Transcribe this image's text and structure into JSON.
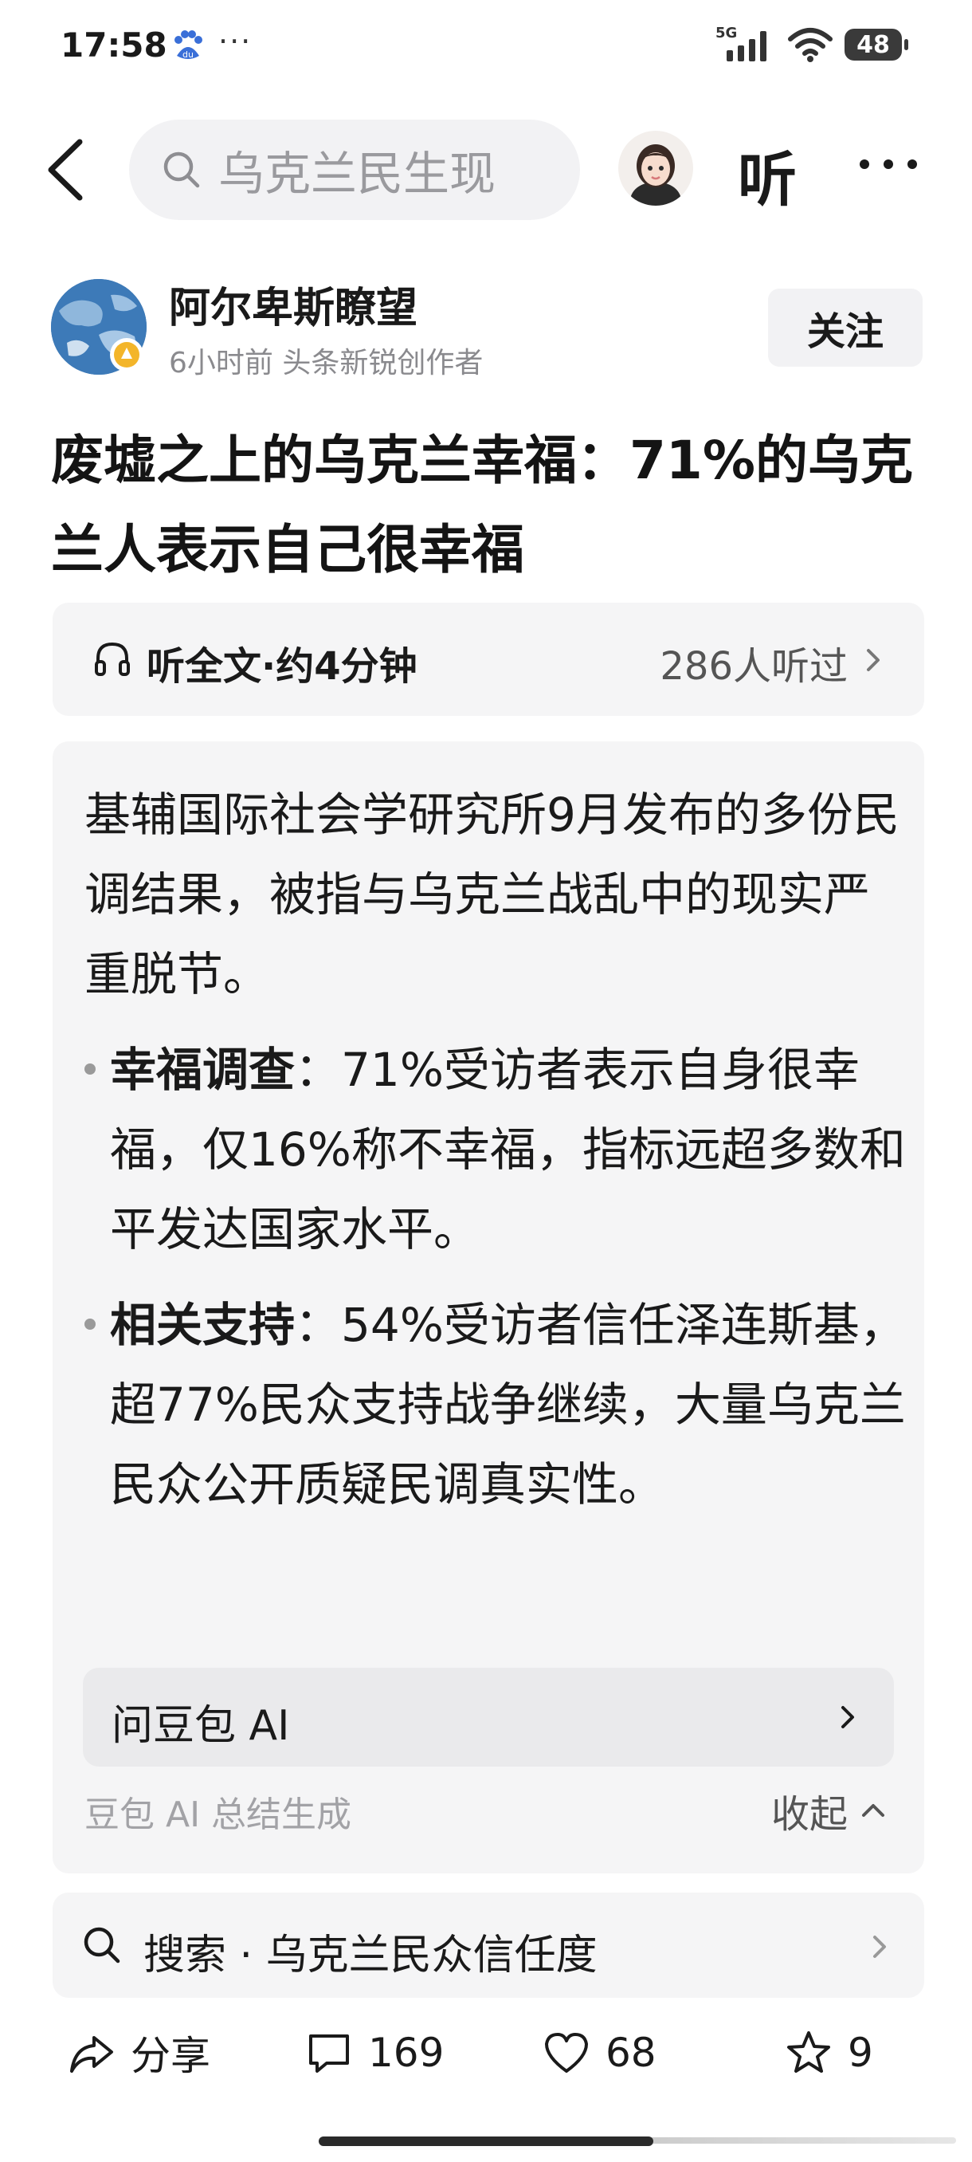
{
  "status_bar": {
    "time": "17:58",
    "network": "5G",
    "battery": "48"
  },
  "nav": {
    "search_text": "乌克兰民生现",
    "listen_label": "听"
  },
  "author": {
    "name": "阿尔卑斯瞭望",
    "meta": "6小时前  头条新锐创作者",
    "follow_label": "关注"
  },
  "article": {
    "title": "废墟之上的乌克兰幸福：71%的乌克兰人表示自己很幸福"
  },
  "listen_bar": {
    "label": "听全文·约4分钟",
    "count": "286人听过"
  },
  "summary": {
    "intro": "基辅国际社会学研究所9月发布的多份民调结果，被指与乌克兰战乱中的现实严重脱节。",
    "bullets": [
      {
        "head": "幸福调查",
        "text": "：71%受访者表示自身很幸福，仅16%称不幸福，指标远超多数和平发达国家水平。"
      },
      {
        "head": "相关支持",
        "text": "：54%受访者信任泽连斯基，超77%民众支持战争继续，大量乌克兰民众公开质疑民调真实性。"
      }
    ],
    "ask_ai": "问豆包 AI",
    "source": "豆包 AI 总结生成",
    "collapse": "收起"
  },
  "suggestion": {
    "text": "搜索 · 乌克兰民众信任度"
  },
  "actions": {
    "share": "分享",
    "comments": "169",
    "likes": "68",
    "favorites": "9"
  },
  "colors": {
    "card_bg": "#f5f5f6",
    "text": "#1a1a1a",
    "muted": "#8a8a8e"
  }
}
